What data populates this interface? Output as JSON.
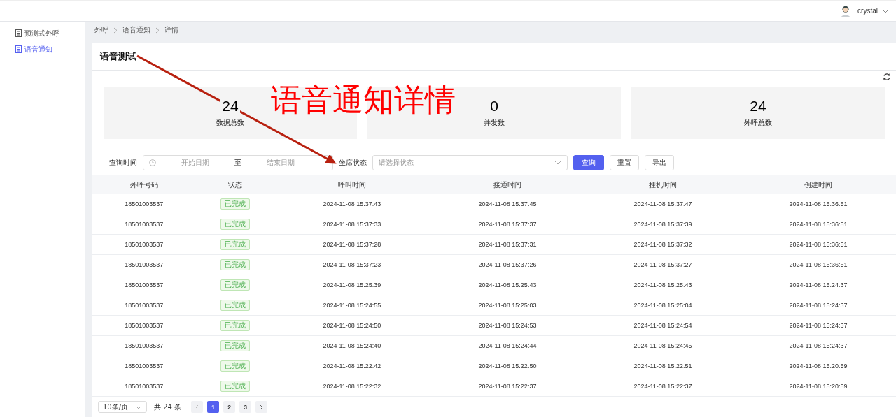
{
  "header": {
    "username": "crystal"
  },
  "sidebar": {
    "items": [
      {
        "label": "预测式外呼",
        "selected": false
      },
      {
        "label": "语音通知",
        "selected": true
      }
    ]
  },
  "breadcrumb": [
    "外呼",
    "语音通知",
    "详情"
  ],
  "page_title": "语音测试",
  "stats": [
    {
      "value": "24",
      "label": "数据总数"
    },
    {
      "value": "0",
      "label": "并发数"
    },
    {
      "value": "24",
      "label": "外呼总数"
    }
  ],
  "filters": {
    "time_label": "查询时间",
    "start_placeholder": "开始日期",
    "separator": "至",
    "end_placeholder": "结束日期",
    "status_label": "坐席状态",
    "status_placeholder": "请选择状态",
    "buttons": [
      {
        "label": "查询",
        "kind": "primary"
      },
      {
        "label": "重置",
        "kind": "default"
      },
      {
        "label": "导出",
        "kind": "default"
      }
    ]
  },
  "table": {
    "columns": [
      "外呼号码",
      "状态",
      "呼叫时间",
      "接通时间",
      "挂机时间",
      "创建时间"
    ],
    "rows": [
      [
        "18501003537",
        "已完成",
        "2024-11-08 15:37:43",
        "2024-11-08 15:37:45",
        "2024-11-08 15:37:47",
        "2024-11-08 15:36:51"
      ],
      [
        "18501003537",
        "已完成",
        "2024-11-08 15:37:33",
        "2024-11-08 15:37:37",
        "2024-11-08 15:37:39",
        "2024-11-08 15:36:51"
      ],
      [
        "18501003537",
        "已完成",
        "2024-11-08 15:37:28",
        "2024-11-08 15:37:31",
        "2024-11-08 15:37:32",
        "2024-11-08 15:36:51"
      ],
      [
        "18501003537",
        "已完成",
        "2024-11-08 15:37:23",
        "2024-11-08 15:37:26",
        "2024-11-08 15:37:27",
        "2024-11-08 15:36:51"
      ],
      [
        "18501003537",
        "已完成",
        "2024-11-08 15:25:39",
        "2024-11-08 15:25:43",
        "2024-11-08 15:25:43",
        "2024-11-08 15:24:37"
      ],
      [
        "18501003537",
        "已完成",
        "2024-11-08 15:24:55",
        "2024-11-08 15:25:03",
        "2024-11-08 15:25:04",
        "2024-11-08 15:24:37"
      ],
      [
        "18501003537",
        "已完成",
        "2024-11-08 15:24:50",
        "2024-11-08 15:24:53",
        "2024-11-08 15:24:54",
        "2024-11-08 15:24:37"
      ],
      [
        "18501003537",
        "已完成",
        "2024-11-08 15:24:40",
        "2024-11-08 15:24:44",
        "2024-11-08 15:24:45",
        "2024-11-08 15:24:37"
      ],
      [
        "18501003537",
        "已完成",
        "2024-11-08 15:22:42",
        "2024-11-08 15:22:50",
        "2024-11-08 15:22:51",
        "2024-11-08 15:20:59"
      ],
      [
        "18501003537",
        "已完成",
        "2024-11-08 15:22:32",
        "2024-11-08 15:22:37",
        "2024-11-08 15:22:37",
        "2024-11-08 15:20:59"
      ]
    ]
  },
  "pagination": {
    "page_size": "10条/页",
    "total": "共 24 条",
    "pages": [
      {
        "label": "1",
        "selected": true
      },
      {
        "label": "2",
        "selected": false
      },
      {
        "label": "3",
        "selected": false
      }
    ]
  },
  "annotation": {
    "text": "语音通知详情"
  }
}
